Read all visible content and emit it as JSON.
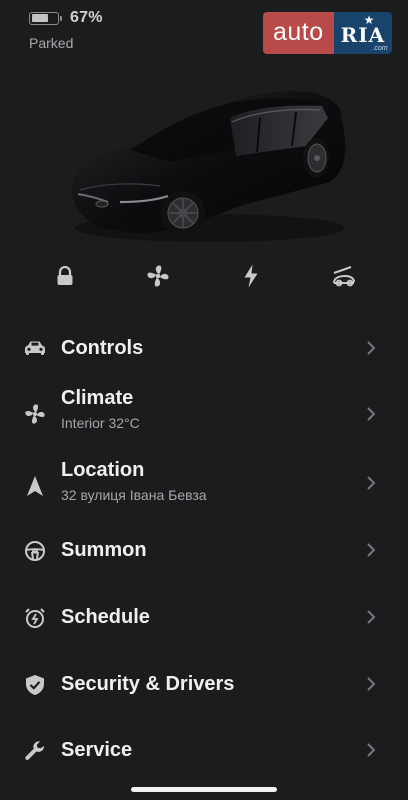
{
  "status": {
    "battery_percent_label": "67%",
    "battery_level": 0.67,
    "state": "Parked"
  },
  "watermark": {
    "left_text": "auto",
    "right_text": "RIA",
    "small_text": ".com"
  },
  "quick_controls": [
    {
      "icon": "lock-icon"
    },
    {
      "icon": "fan-icon"
    },
    {
      "icon": "lightning-icon"
    },
    {
      "icon": "frunk-icon"
    }
  ],
  "menu": {
    "items": [
      {
        "label": "Controls",
        "sub": "",
        "icon": "car-icon"
      },
      {
        "label": "Climate",
        "sub": "Interior 32°C",
        "icon": "fan-icon"
      },
      {
        "label": "Location",
        "sub": "32 вулиця Івана Бевза",
        "icon": "location-arrow-icon"
      },
      {
        "label": "Summon",
        "sub": "",
        "icon": "steering-wheel-icon"
      },
      {
        "label": "Schedule",
        "sub": "",
        "icon": "alarm-clock-icon"
      },
      {
        "label": "Security & Drivers",
        "sub": "",
        "icon": "shield-check-icon"
      },
      {
        "label": "Service",
        "sub": "",
        "icon": "wrench-icon"
      }
    ]
  },
  "colors": {
    "background": "#1b1c1e",
    "text": "#f0f0f1",
    "subtext": "#a6a6a9",
    "icon": "#cfcfd2",
    "watermark_red": "#b94a4a",
    "watermark_blue": "#17436c"
  }
}
